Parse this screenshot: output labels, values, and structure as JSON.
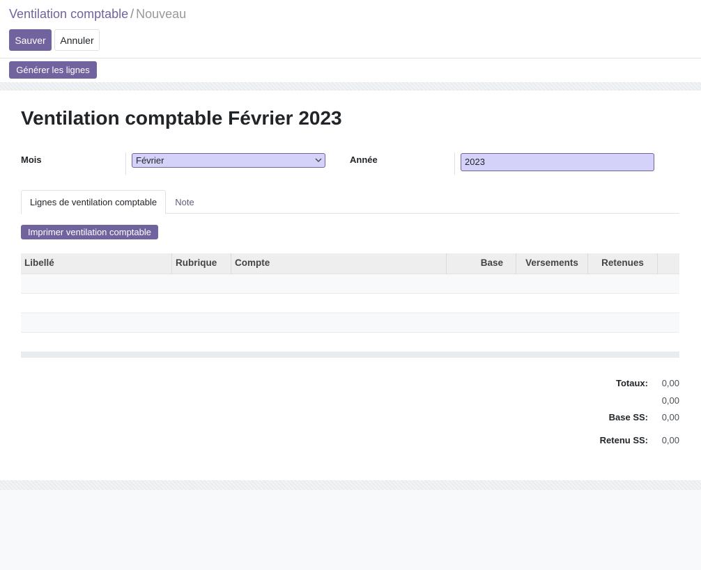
{
  "breadcrumb": {
    "parent": "Ventilation comptable",
    "separator": "/",
    "current": "Nouveau"
  },
  "control_panel": {
    "save_label": "Sauver",
    "cancel_label": "Annuler"
  },
  "statusbar": {
    "generate_label": "Générer les lignes"
  },
  "form": {
    "title": "Ventilation comptable Février 2023",
    "month_label": "Mois",
    "month_value": "Février",
    "year_label": "Année",
    "year_value": "2023"
  },
  "tabs": [
    {
      "label": "Lignes de ventilation comptable",
      "active": true
    },
    {
      "label": "Note",
      "active": false
    }
  ],
  "lines": {
    "print_label": "Imprimer ventilation comptable",
    "columns": [
      "Libellé",
      "Rubrique",
      "Compte",
      "Base",
      "Versements",
      "Retenues"
    ],
    "rows": []
  },
  "totals": {
    "totaux_label": "Totaux:",
    "totaux_value_1": "0,00",
    "totaux_value_2": "0,00",
    "base_ss_label": "Base SS:",
    "base_ss_value": "0,00",
    "retenu_ss_label": "Retenu SS:",
    "retenu_ss_value": "0,00"
  },
  "colors": {
    "primary": "#71639e",
    "input_bg": "#d4d2f8"
  },
  "icons": {
    "select_chevron": "chevron-down-icon"
  }
}
